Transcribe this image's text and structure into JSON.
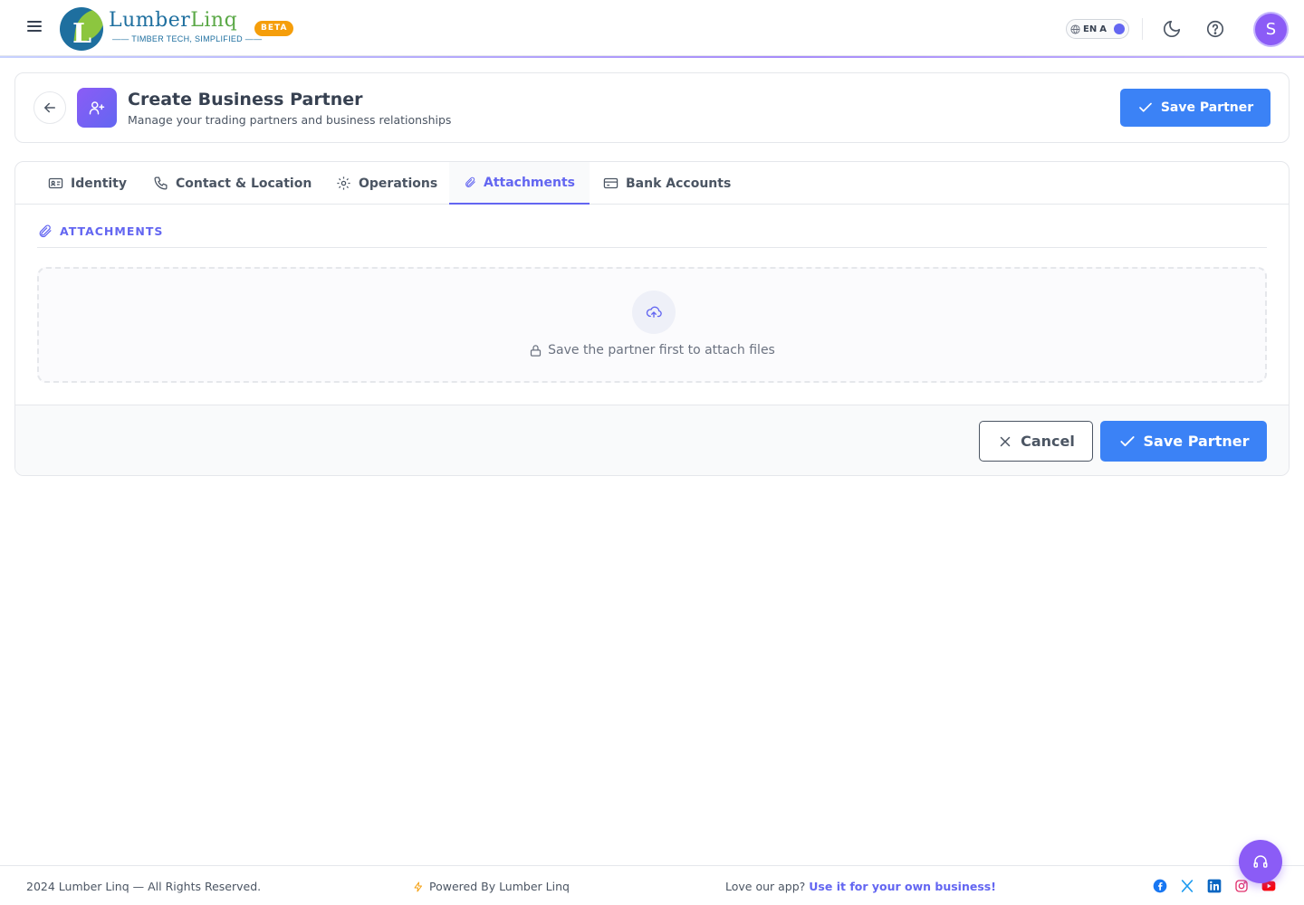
{
  "brand": {
    "name_part1": "Lumber",
    "name_part2": "Linq",
    "tagline": "—— TIMBER TECH, SIMPLIFIED ——",
    "logo_letter": "L",
    "badge": "BETA"
  },
  "topbar": {
    "lang_code": "EN",
    "lang_alt": "A",
    "avatar_initial": "S"
  },
  "header": {
    "title": "Create Business Partner",
    "subtitle": "Manage your trading partners and business relationships",
    "save_label": "Save Partner"
  },
  "tabs": [
    {
      "label": "Identity",
      "icon": "id-card-icon"
    },
    {
      "label": "Contact & Location",
      "icon": "phone-icon"
    },
    {
      "label": "Operations",
      "icon": "gear-icon"
    },
    {
      "label": "Attachments",
      "icon": "paperclip-icon",
      "active": true
    },
    {
      "label": "Bank Accounts",
      "icon": "credit-card-icon"
    }
  ],
  "attachments": {
    "section_title": "ATTACHMENTS",
    "empty_message": "Save the partner first to attach files"
  },
  "actions": {
    "cancel_label": "Cancel",
    "save_label": "Save Partner"
  },
  "footer": {
    "copyright": "2024 Lumber Linq — All Rights Reserved.",
    "powered_by": "Powered By Lumber Linq",
    "promo_text": "Love our app? ",
    "promo_link": "Use it for your own business!"
  },
  "colors": {
    "primary": "#3b82f6",
    "accent": "#6366f1",
    "purple": "#8b5cf6",
    "beta": "#f59e0b"
  }
}
